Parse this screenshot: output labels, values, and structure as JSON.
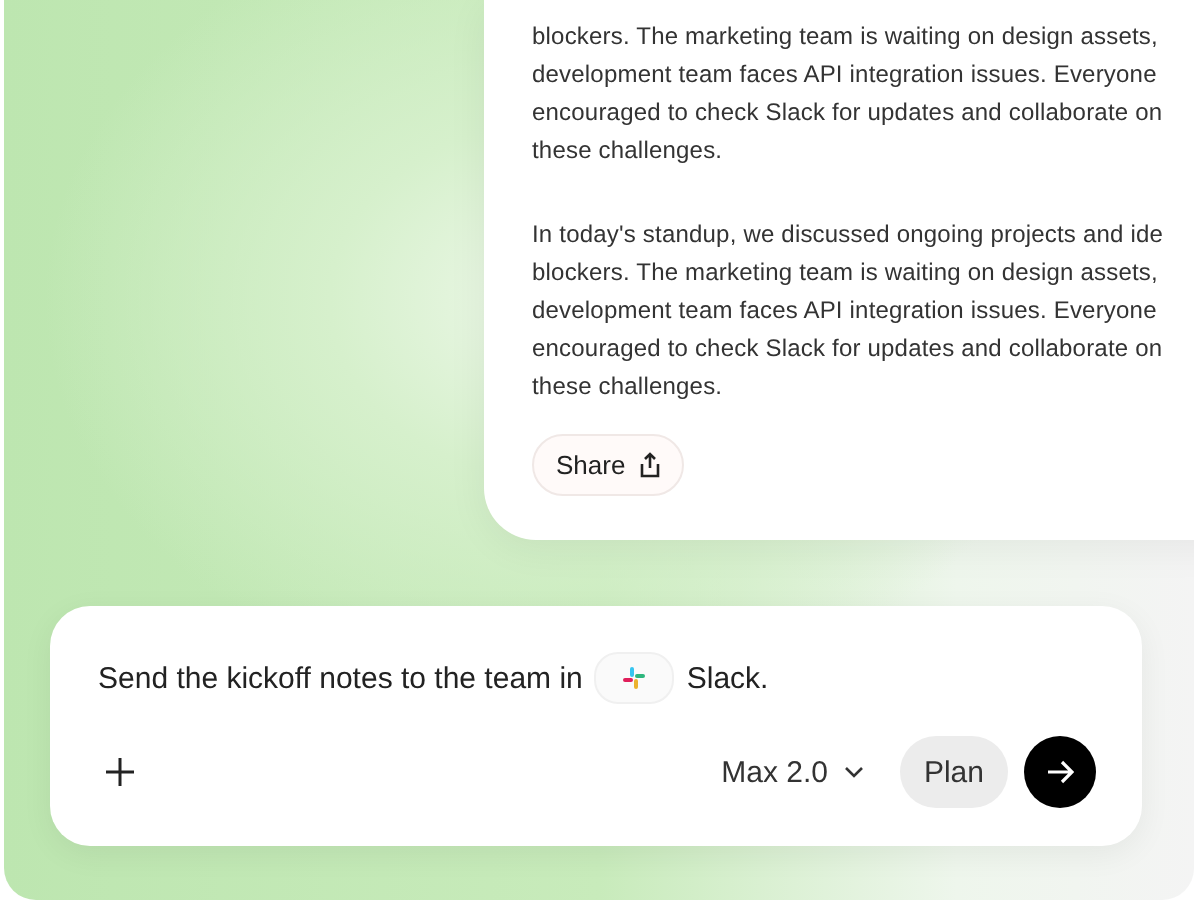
{
  "document": {
    "paragraphs": [
      "blockers. The marketing team is waiting on design assets,\ndevelopment team faces API integration issues. Everyone\nencouraged to check Slack for updates and collaborate on\nthese challenges.",
      "In today's standup, we discussed ongoing projects and ide\nblockers. The marketing team is waiting on design assets,\ndevelopment team faces API integration issues. Everyone\nencouraged to check Slack for updates and collaborate on\nthese challenges."
    ],
    "share_button": "Share"
  },
  "composer": {
    "text_before": "Send the kickoff notes to the team in",
    "text_after": "Slack.",
    "model": "Max 2.0",
    "plan_button": "Plan"
  }
}
